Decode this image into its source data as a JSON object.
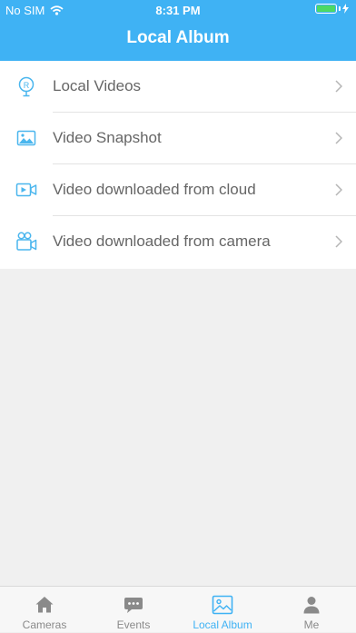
{
  "status_bar": {
    "carrier": "No SIM",
    "time": "8:31 PM"
  },
  "header": {
    "title": "Local Album"
  },
  "list": {
    "items": [
      {
        "label": "Local Videos",
        "icon": "map-pin-record-icon"
      },
      {
        "label": "Video Snapshot",
        "icon": "image-icon"
      },
      {
        "label": "Video downloaded from cloud",
        "icon": "video-player-icon"
      },
      {
        "label": "Video downloaded from camera",
        "icon": "video-camera-icon"
      }
    ]
  },
  "tabbar": {
    "tabs": [
      {
        "label": "Cameras",
        "icon": "home-icon",
        "active": false
      },
      {
        "label": "Events",
        "icon": "chat-bubble-icon",
        "active": false
      },
      {
        "label": "Local Album",
        "icon": "photo-album-icon",
        "active": true
      },
      {
        "label": "Me",
        "icon": "person-icon",
        "active": false
      }
    ]
  },
  "colors": {
    "accent": "#3fb2f4",
    "battery": "#4cd964",
    "inactive": "#8a8a8a"
  }
}
